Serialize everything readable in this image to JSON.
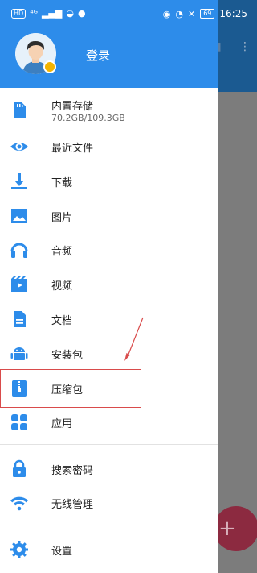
{
  "status_bar": {
    "left": [
      "HD",
      "⁴ᴳ"
    ],
    "battery": "69",
    "time": "16:25"
  },
  "header": {
    "login_label": "登录"
  },
  "menu": [
    {
      "label": "内置存储",
      "sub": "70.2GB/109.3GB",
      "icon": "sd-card-icon"
    },
    {
      "label": "最近文件",
      "icon": "eye-icon"
    },
    {
      "label": "下载",
      "icon": "download-icon"
    },
    {
      "label": "图片",
      "icon": "image-icon"
    },
    {
      "label": "音频",
      "icon": "headphones-icon"
    },
    {
      "label": "视频",
      "icon": "video-icon"
    },
    {
      "label": "文档",
      "icon": "document-icon"
    },
    {
      "label": "安装包",
      "icon": "android-icon"
    },
    {
      "label": "压缩包",
      "icon": "zip-icon"
    },
    {
      "label": "应用",
      "icon": "apps-icon"
    },
    {
      "label": "搜索密码",
      "icon": "lock-icon"
    },
    {
      "label": "无线管理",
      "icon": "wifi-icon"
    },
    {
      "label": "设置",
      "icon": "gear-icon"
    }
  ],
  "colors": {
    "accent": "#2d8cea",
    "icon": "#2d8cea",
    "annotation": "#d94b4b"
  }
}
